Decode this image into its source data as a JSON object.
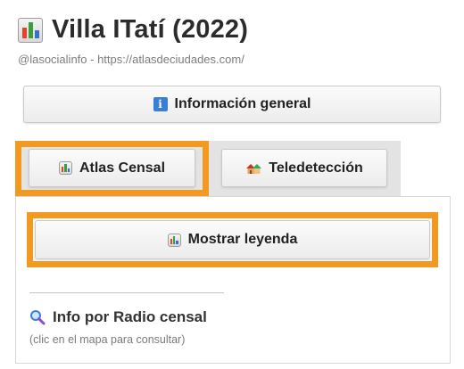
{
  "header": {
    "title": "Villa ITatí (2022)",
    "subtitle": "@lasocialinfo - https://atlasdeciudades.com/"
  },
  "buttons": {
    "general_info": "Información general",
    "show_legend": "Mostrar leyenda"
  },
  "tabs": [
    {
      "label": "Atlas Censal",
      "icon": "bar-chart-icon",
      "active": true
    },
    {
      "label": "Teledetección",
      "icon": "house-icon",
      "active": false
    }
  ],
  "radio_info": {
    "title": "Info por Radio censal",
    "hint": "(clic en el mapa para consultar)"
  },
  "colors": {
    "accent_orange": "#f29a1f",
    "info_blue": "#3a7fd5"
  }
}
